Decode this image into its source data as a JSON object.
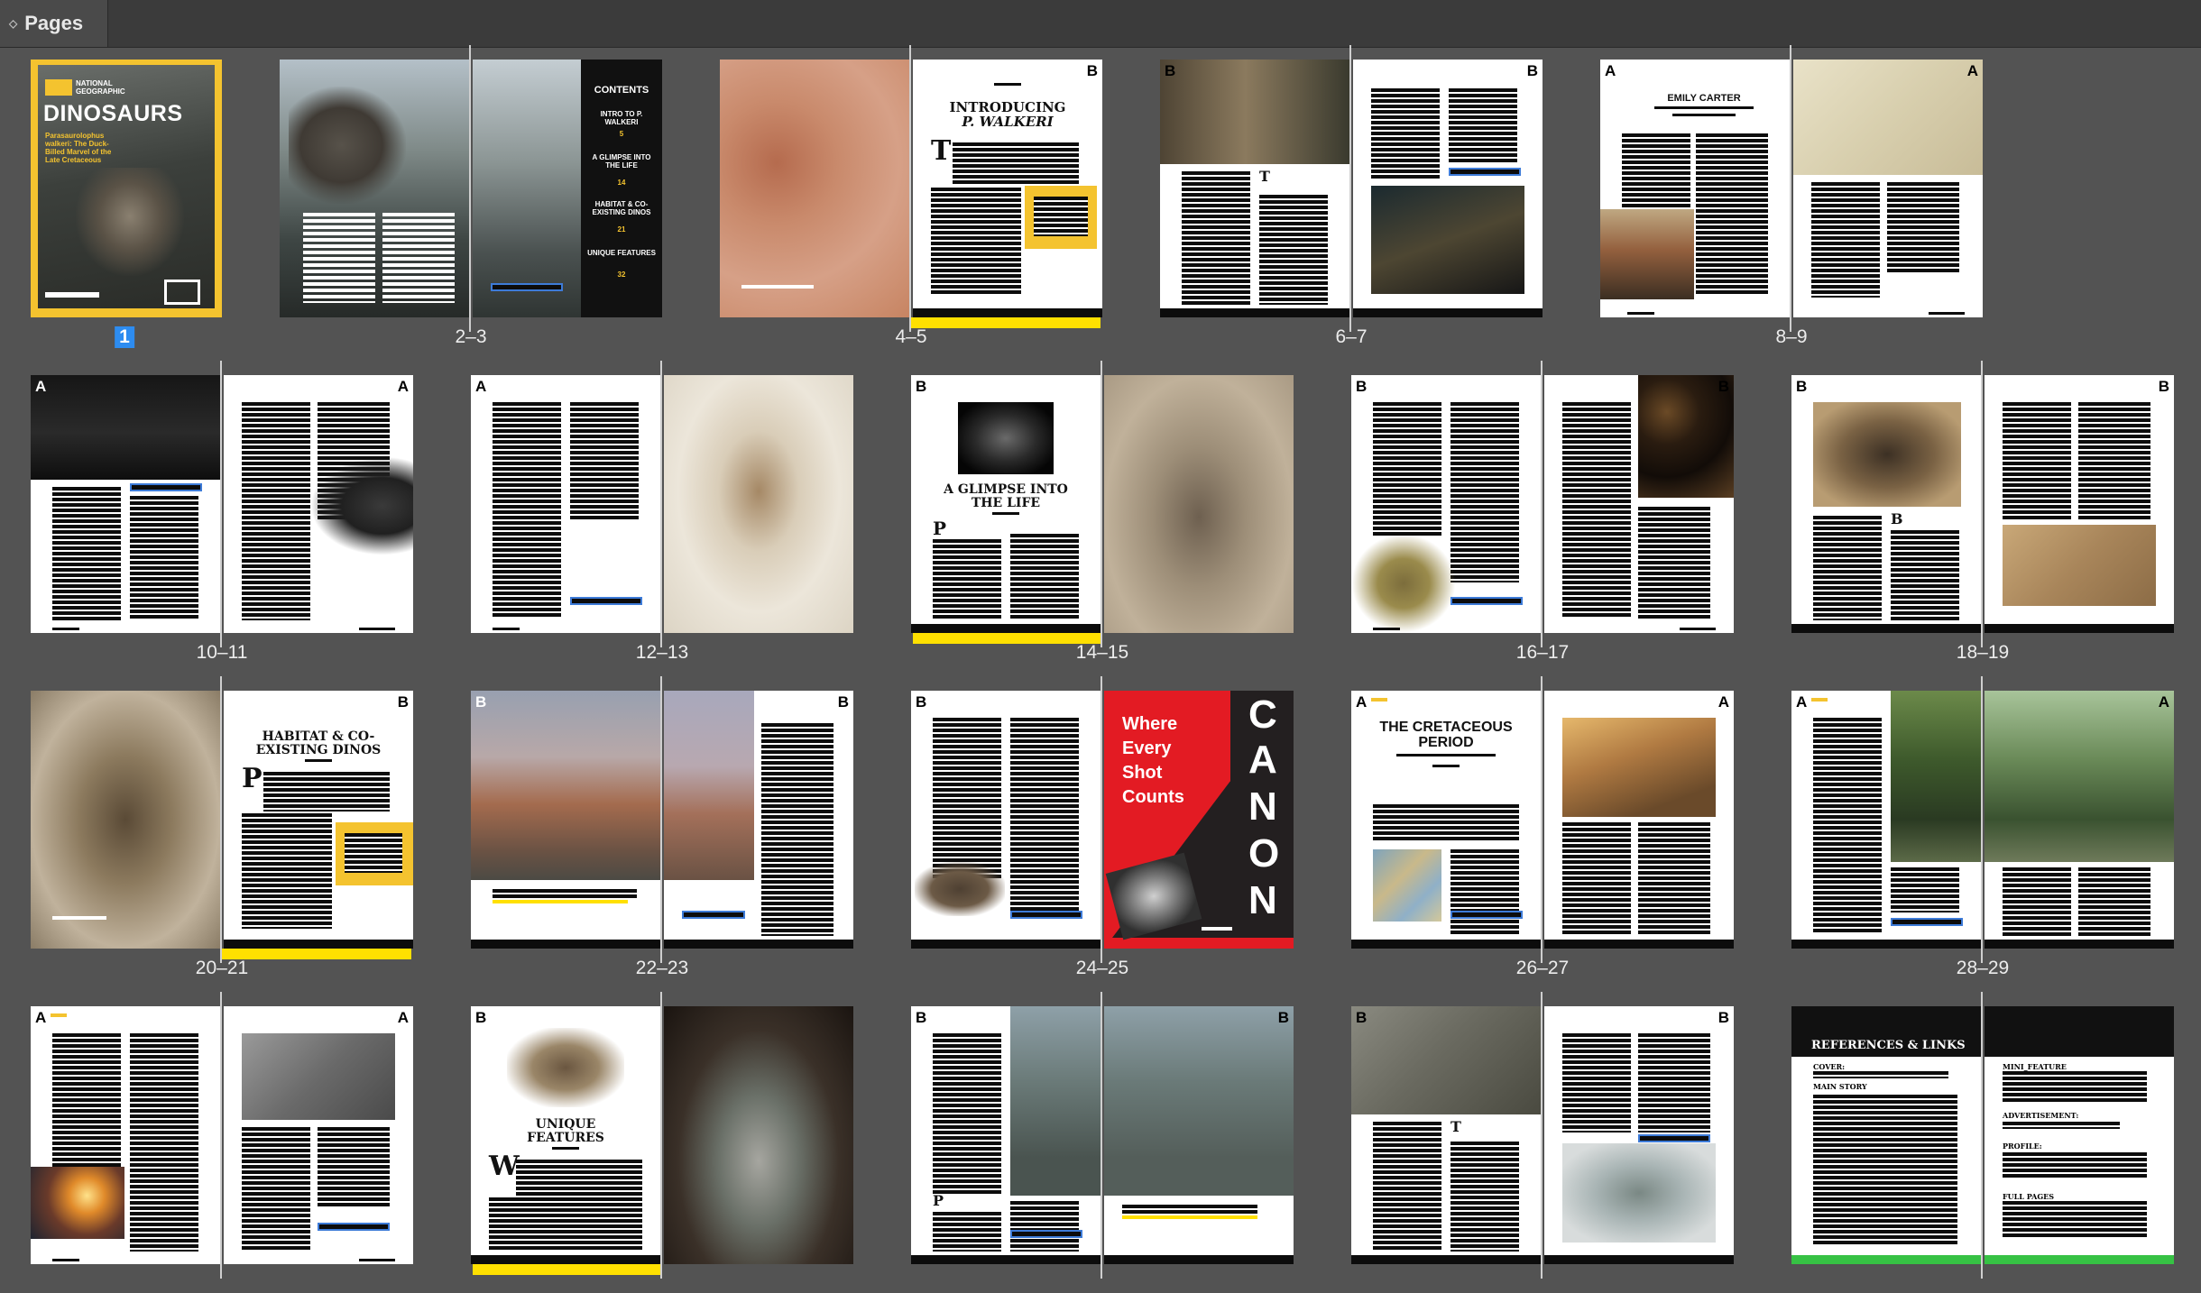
{
  "panel": {
    "title": "Pages"
  },
  "spreads": [
    {
      "caption": "1",
      "selected": true
    },
    {
      "caption": "2–3"
    },
    {
      "caption": "4–5",
      "left_master": "",
      "right_master": "B"
    },
    {
      "caption": "6–7",
      "left_master": "B",
      "right_master": "B"
    },
    {
      "caption": "8–9",
      "left_master": "A",
      "right_master": "A"
    },
    {
      "caption": "10–11",
      "left_master": "A",
      "right_master": "A"
    },
    {
      "caption": "12–13",
      "left_master": "A",
      "right_master": ""
    },
    {
      "caption": "14–15",
      "left_master": "B",
      "right_master": ""
    },
    {
      "caption": "16–17",
      "left_master": "B",
      "right_master": "B"
    },
    {
      "caption": "18–19",
      "left_master": "B",
      "right_master": "B"
    },
    {
      "caption": "20–21",
      "left_master": "",
      "right_master": "B"
    },
    {
      "caption": "22–23",
      "left_master": "B",
      "right_master": "B"
    },
    {
      "caption": "24–25",
      "left_master": "B",
      "right_master": ""
    },
    {
      "caption": "26–27",
      "left_master": "A",
      "right_master": "A"
    },
    {
      "caption": "28–29",
      "left_master": "A",
      "right_master": "A"
    },
    {
      "caption": "",
      "left_master": "A",
      "right_master": "A"
    },
    {
      "caption": "",
      "left_master": "B",
      "right_master": ""
    },
    {
      "caption": "",
      "left_master": "B",
      "right_master": "B"
    },
    {
      "caption": "",
      "left_master": "B",
      "right_master": "B"
    },
    {
      "caption": "",
      "left_master": "",
      "right_master": ""
    }
  ],
  "content": {
    "cover": {
      "brand": "NATIONAL GEOGRAPHIC",
      "title": "DINOSAURS",
      "subtitle": "Parasaurolophus walkeri: The Duck-Billed Marvel of the Late Cretaceous"
    },
    "contents": {
      "heading": "CONTENTS",
      "items": [
        "INTRO TO P. WALKERI",
        "A GLIMPSE INTO THE LIFE",
        "HABITAT & CO-EXISTING DINOS",
        "UNIQUE FEATURES"
      ],
      "pages": [
        "5",
        "14",
        "21",
        "32"
      ]
    },
    "spread_4_5": {
      "heading_line1": "INTRODUCING",
      "heading_line2": "P. WALKERI",
      "drop_cap": "T"
    },
    "spread_6_7": {
      "drop_cap": "T"
    },
    "spread_8_9": {
      "byline": "EMILY CARTER"
    },
    "spread_14_15": {
      "heading": "A GLIMPSE INTO THE LIFE",
      "drop_cap": "P"
    },
    "spread_18_19": {
      "drop_cap": "B"
    },
    "spread_20_21": {
      "heading": "HABITAT & CO-EXISTING DINOS",
      "drop_cap": "P"
    },
    "spread_24_25": {
      "ad_tagline": [
        "Where",
        "Every",
        "Shot",
        "Counts"
      ],
      "ad_brand_letters": [
        "C",
        "A",
        "N",
        "O",
        "N"
      ]
    },
    "spread_26_27": {
      "heading": "THE CRETACEOUS PERIOD"
    },
    "spread_32_33": {
      "heading": "UNIQUE FEATURES",
      "drop_cap": "W"
    },
    "spread_34_35": {
      "drop_cap": "P"
    },
    "spread_36_37": {
      "drop_cap": "T"
    },
    "spread_38_39": {
      "heading": "REFERENCES & LINKS",
      "left_sections": [
        "COVER:",
        "MAIN STORY"
      ],
      "right_sections": [
        "MINI_FEATURE",
        "ADVERTISEMENT:",
        "PROFILE:",
        "FULL PAGES"
      ]
    }
  },
  "colors": {
    "panel_bg": "#535353",
    "header_bg": "#3b3b3b",
    "selection": "#2d8cf0",
    "accent_yellow": "#ffe000",
    "accent_green": "#36c244",
    "cover_border": "#f4c32f",
    "ad_red": "#e31b23"
  }
}
